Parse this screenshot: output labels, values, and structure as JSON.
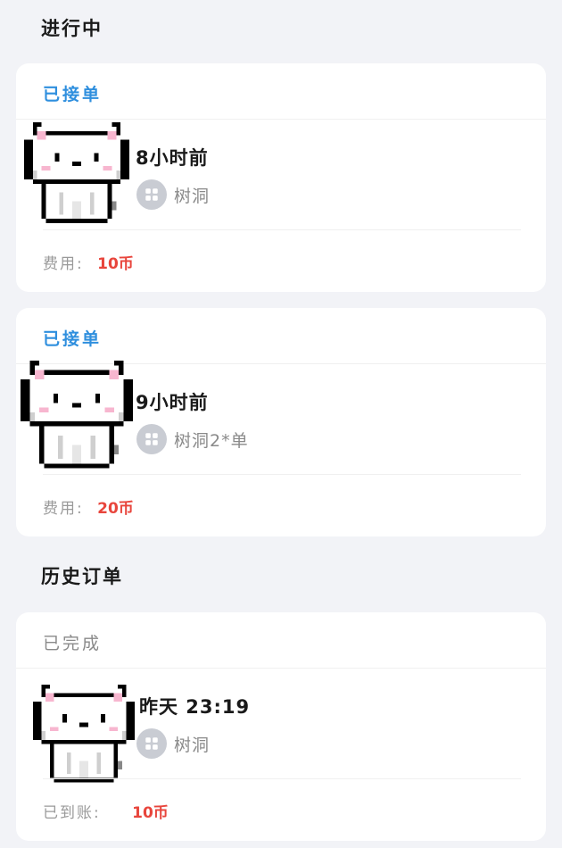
{
  "sections": {
    "in_progress_title": "进行中",
    "history_title": "历史订单"
  },
  "orders": [
    {
      "status": "已接单",
      "time": "8小时前",
      "service": "树洞",
      "fee_label": "费用:",
      "fee_value": "10币",
      "service_icon": "grid-icon"
    },
    {
      "status": "已接单",
      "time": "9小时前",
      "service": "树洞2*单",
      "fee_label": "费用:",
      "fee_value": "20币",
      "service_icon": "grid-icon"
    }
  ],
  "history": [
    {
      "status": "已完成",
      "time": "昨天 23:19",
      "service": "树洞",
      "fee_label": "已到账:",
      "fee_value": "10币",
      "service_icon": "grid-icon"
    }
  ],
  "colors": {
    "accepted": "#2f8fde",
    "fee": "#e8453c",
    "page_bg": "#f2f3f7"
  }
}
